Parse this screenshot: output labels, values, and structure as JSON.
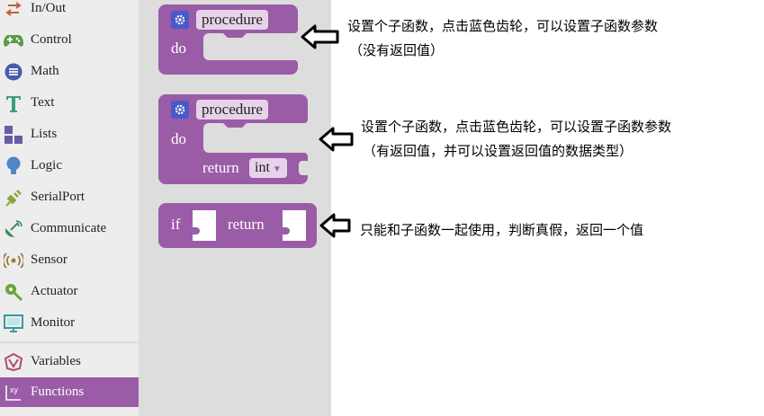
{
  "sidebar": {
    "items": [
      {
        "label": "In/Out",
        "icon": "in-out-arrows-icon"
      },
      {
        "label": "Control",
        "icon": "gamepad-icon"
      },
      {
        "label": "Math",
        "icon": "math-icon"
      },
      {
        "label": "Text",
        "icon": "text-t-icon"
      },
      {
        "label": "Lists",
        "icon": "lists-icon"
      },
      {
        "label": "Logic",
        "icon": "logic-bulb-icon"
      },
      {
        "label": "SerialPort",
        "icon": "serialport-plug-icon"
      },
      {
        "label": "Communicate",
        "icon": "antenna-icon"
      },
      {
        "label": "Sensor",
        "icon": "sensor-icon"
      },
      {
        "label": "Actuator",
        "icon": "actuator-icon"
      },
      {
        "label": "Monitor",
        "icon": "monitor-icon"
      },
      {
        "label": "Variables",
        "icon": "variables-icon"
      },
      {
        "label": "Functions",
        "icon": "functions-icon"
      }
    ],
    "selected": "Functions"
  },
  "flyout": {
    "procedure_block": {
      "name": "procedure",
      "do_label": "do"
    },
    "procedure_return_block": {
      "name": "procedure",
      "do_label": "do",
      "return_label": "return",
      "type": "int"
    },
    "if_return_block": {
      "if_label": "if",
      "return_label": "return"
    }
  },
  "notes": {
    "note1_line1": "设置个子函数，点击蓝色齿轮，可以设置子函数参数",
    "note1_line2": "（没有返回值）",
    "note2_line1": "设置个子函数，点击蓝色齿轮，可以设置子函数参数",
    "note2_line2": "（有返回值，并可以设置返回值的数据类型）",
    "note3_line1": "只能和子函数一起使用，判断真假，返回一个值"
  },
  "colors": {
    "block": "#9a5ca6",
    "block_light": "#e6d3ea",
    "gear": "#4a59c9",
    "selected_category": "#9a5ca6",
    "flyout_bg": "#dddddd",
    "sidebar_bg": "#ededed"
  }
}
